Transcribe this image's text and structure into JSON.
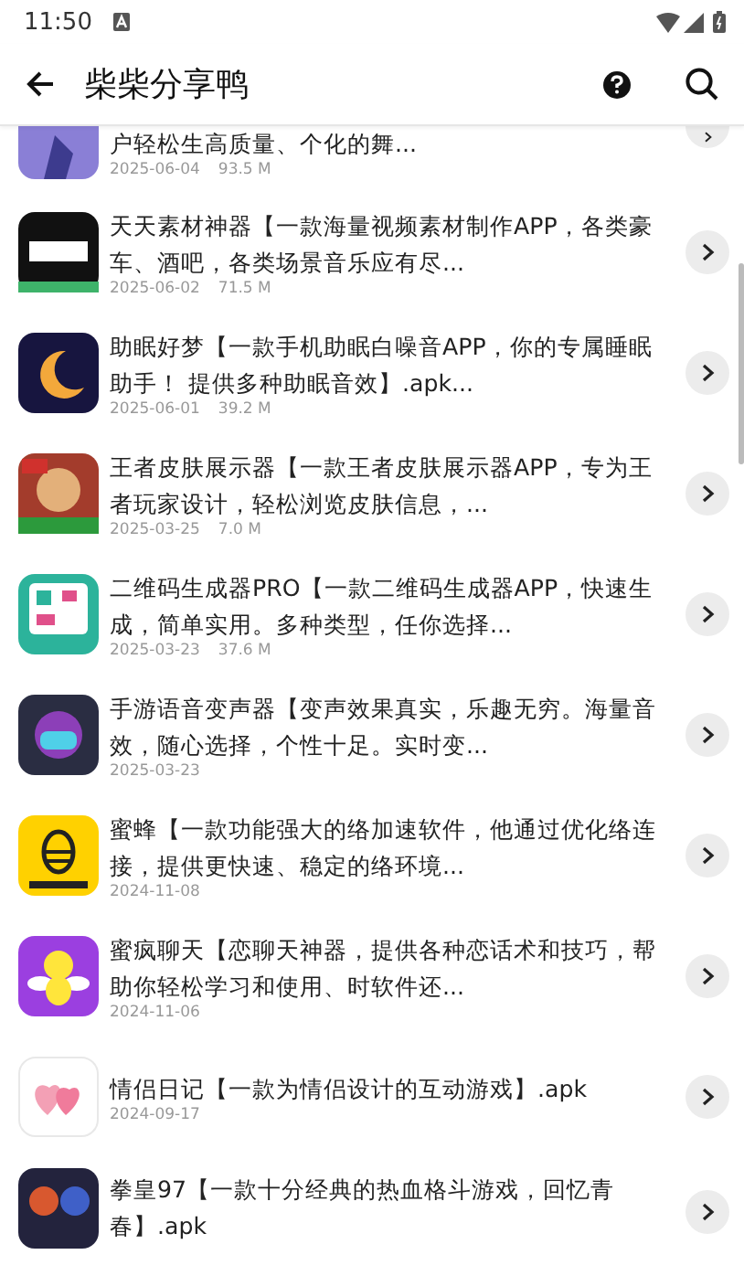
{
  "status_bar": {
    "time": "11:50"
  },
  "app_bar": {
    "title": "柴柴分享鸭"
  },
  "items": [
    {
      "title": "户轻松生高质量、个化的舞...",
      "date": "2025-06-04",
      "size": "93.5 M"
    },
    {
      "title": "天天素材神器【一款海量视频素材制作APP，各类豪车、酒吧，各类场景音乐应有尽...",
      "date": "2025-06-02",
      "size": "71.5 M"
    },
    {
      "title": "助眠好梦【一款手机助眠白噪音APP，你的专属睡眠助手！ 提供多种助眠音效】.apk...",
      "date": "2025-06-01",
      "size": "39.2 M"
    },
    {
      "title": "王者皮肤展示器【一款王者皮肤展示器APP，专为王者玩家设计，轻松浏览皮肤信息，...",
      "date": "2025-03-25",
      "size": "7.0 M"
    },
    {
      "title": "二维码生成器PRO【一款二维码生成器APP，快速生成，简单实用。多种类型，任你选择...",
      "date": "2025-03-23",
      "size": "37.6 M"
    },
    {
      "title": "手游语音变声器【变声效果真实，乐趣无穷。海量音效，随心选择，个性十足。实时变...",
      "date": "2025-03-23"
    },
    {
      "title": "蜜蜂【一款功能强大的络加速软件，他通过优化络连接，提供更快速、稳定的络环境...",
      "date": "2024-11-08"
    },
    {
      "title": "蜜疯聊天【恋聊天神器，提供各种恋话术和技巧，帮助你轻松学习和使用、时软件还...",
      "date": "2024-11-06"
    },
    {
      "title": "情侣日记【一款为情侣设计的互动游戏】.apk",
      "date": "2024-09-17"
    },
    {
      "title": "拳皇97【一款十分经典的热血格斗游戏，回忆青春】.apk"
    }
  ]
}
